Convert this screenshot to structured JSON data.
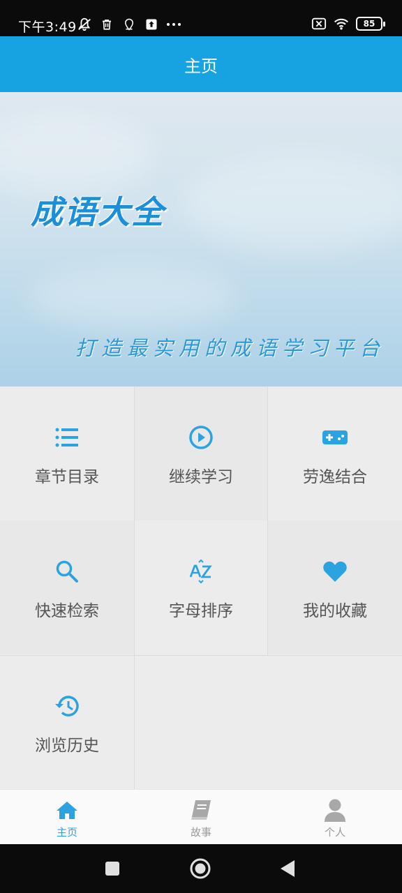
{
  "status_bar": {
    "time": "下午3:49",
    "battery": "85",
    "left_icons": [
      "mute-icon",
      "trash-icon",
      "location-icon",
      "upload-icon",
      "more-dots-icon"
    ],
    "right_icons": [
      "sim-off-icon",
      "wifi-icon",
      "battery-icon"
    ]
  },
  "header": {
    "title": "主页"
  },
  "banner": {
    "title": "成语大全",
    "subtitle": "打造最实用的成语学习平台"
  },
  "menu": [
    {
      "label": "章节目录",
      "icon": "list-icon"
    },
    {
      "label": "继续学习",
      "icon": "play-circle-icon"
    },
    {
      "label": "劳逸结合",
      "icon": "gamepad-icon"
    },
    {
      "label": "快速检索",
      "icon": "search-icon"
    },
    {
      "label": "字母排序",
      "icon": "az-sort-icon"
    },
    {
      "label": "我的收藏",
      "icon": "heart-icon"
    },
    {
      "label": "浏览历史",
      "icon": "history-icon"
    }
  ],
  "bottom_nav": [
    {
      "label": "主页",
      "icon": "home-icon",
      "active": true
    },
    {
      "label": "故事",
      "icon": "book-icon",
      "active": false
    },
    {
      "label": "个人",
      "icon": "person-icon",
      "active": false
    }
  ],
  "colors": {
    "accent": "#17a3e2",
    "icon_blue": "#2aa3e0",
    "inactive": "#9a9a9a"
  }
}
